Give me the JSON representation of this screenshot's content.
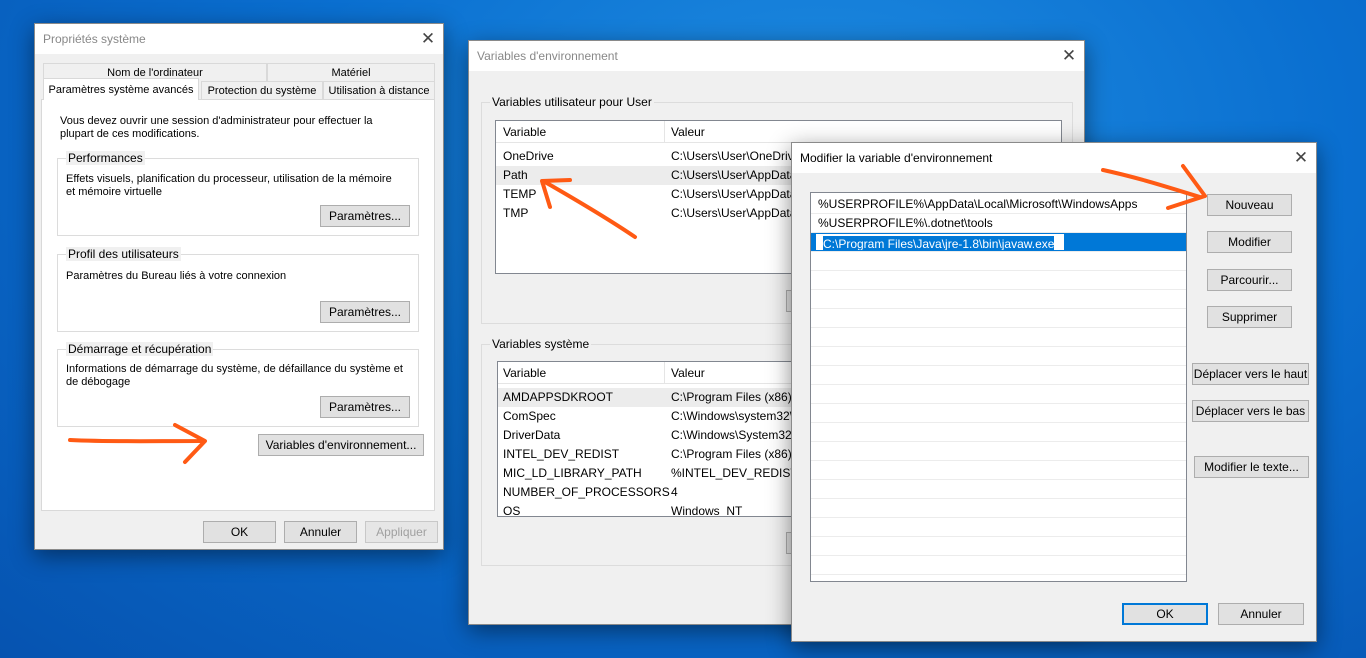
{
  "sys_props": {
    "title": "Propriétés système",
    "tabs_row1": [
      "Nom de l'ordinateur",
      "Matériel"
    ],
    "tabs_row2": [
      "Paramètres système avancés",
      "Protection du système",
      "Utilisation à distance"
    ],
    "admin_note": "Vous devez ouvrir une session d'administrateur pour effectuer la plupart de ces modifications.",
    "performance": {
      "legend": "Performances",
      "desc": "Effets visuels, planification du processeur, utilisation de la mémoire et mémoire virtuelle",
      "button": "Paramètres..."
    },
    "user_profiles": {
      "legend": "Profil des utilisateurs",
      "desc": "Paramètres du Bureau liés à votre connexion",
      "button": "Paramètres..."
    },
    "startup": {
      "legend": "Démarrage et récupération",
      "desc": "Informations de démarrage du système, de défaillance du système et de débogage",
      "button": "Paramètres..."
    },
    "env_button": "Variables d'environnement...",
    "ok": "OK",
    "cancel": "Annuler",
    "apply": "Appliquer"
  },
  "env_vars": {
    "title": "Variables d'environnement",
    "user_group": "Variables utilisateur pour User",
    "col_var": "Variable",
    "col_val": "Valeur",
    "user_rows": [
      {
        "name": "OneDrive",
        "value": "C:\\Users\\User\\OneDrive"
      },
      {
        "name": "Path",
        "value": "C:\\Users\\User\\AppData"
      },
      {
        "name": "TEMP",
        "value": "C:\\Users\\User\\AppData"
      },
      {
        "name": "TMP",
        "value": "C:\\Users\\User\\AppData"
      }
    ],
    "system_group": "Variables système",
    "system_rows": [
      {
        "name": "AMDAPPSDKROOT",
        "value": "C:\\Program Files (x86)\\"
      },
      {
        "name": "ComSpec",
        "value": "C:\\Windows\\system32\\"
      },
      {
        "name": "DriverData",
        "value": "C:\\Windows\\System32\\"
      },
      {
        "name": "INTEL_DEV_REDIST",
        "value": "C:\\Program Files (x86)\\"
      },
      {
        "name": "MIC_LD_LIBRARY_PATH",
        "value": "%INTEL_DEV_REDIST%c"
      },
      {
        "name": "NUMBER_OF_PROCESSORS",
        "value": "4"
      },
      {
        "name": "OS",
        "value": "Windows_NT"
      }
    ]
  },
  "edit_var": {
    "title": "Modifier la variable d'environnement",
    "entries": [
      "%USERPROFILE%\\AppData\\Local\\Microsoft\\WindowsApps",
      "%USERPROFILE%\\.dotnet\\tools",
      "C:\\Program Files\\Java\\jre-1.8\\bin\\javaw.exe"
    ],
    "buttons": {
      "new": "Nouveau",
      "edit": "Modifier",
      "browse": "Parcourir...",
      "delete": "Supprimer",
      "move_up": "Déplacer vers le haut",
      "move_down": "Déplacer vers le bas",
      "edit_text": "Modifier le texte...",
      "ok": "OK",
      "cancel": "Annuler"
    }
  },
  "annotation_color": "#ff5a14",
  "close_glyph": "✕"
}
